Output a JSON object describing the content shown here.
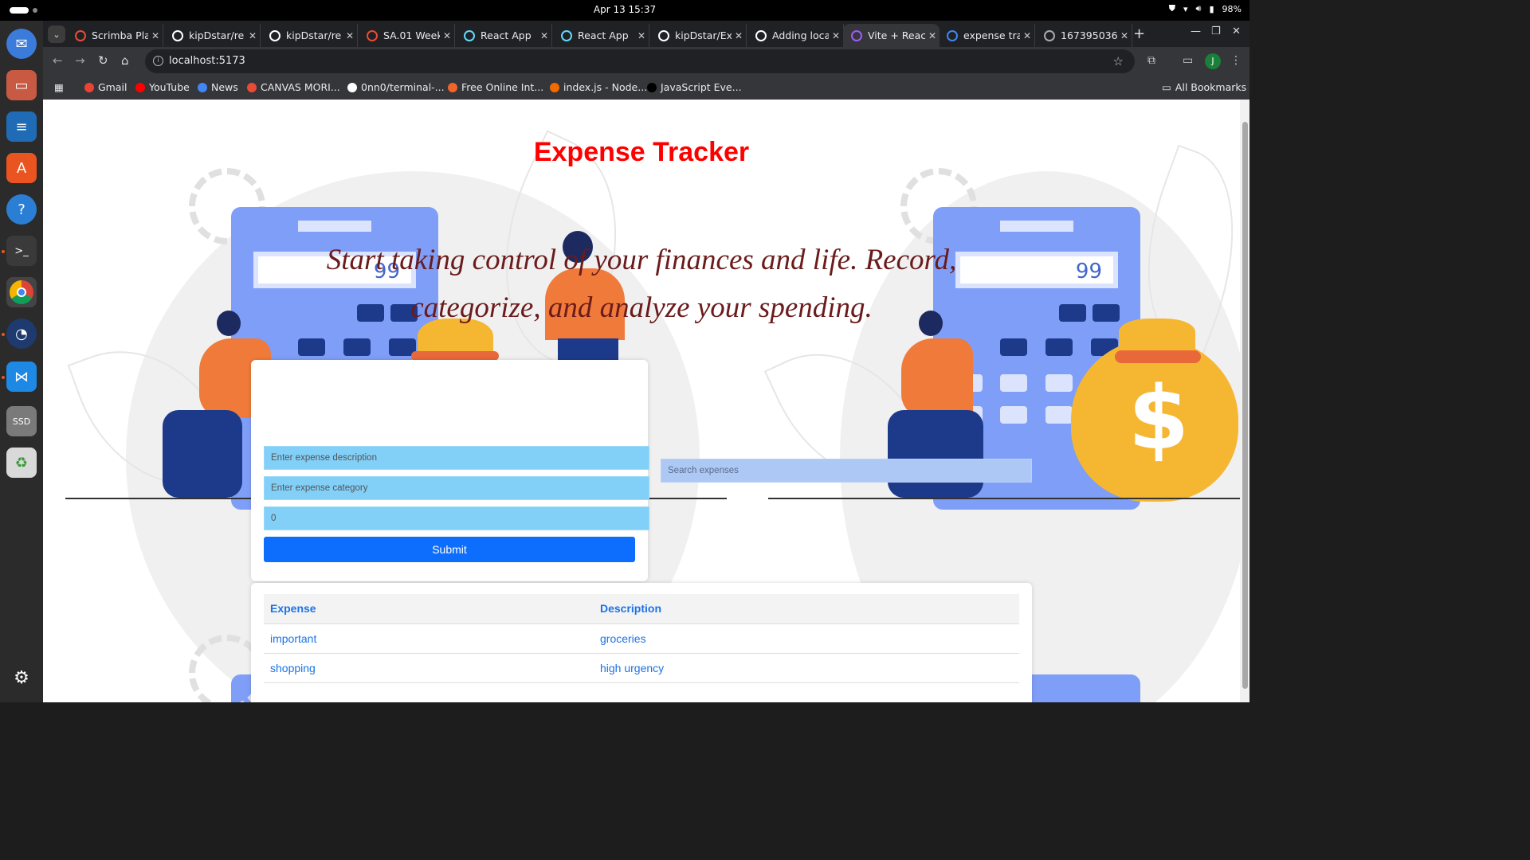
{
  "system_bar": {
    "clock": "Apr 13  15:37",
    "battery": "98%"
  },
  "browser": {
    "tabs": [
      {
        "label": "Scrimba Pla",
        "fav_color": "#e94b35",
        "icon": "scrimba-icon"
      },
      {
        "label": "kipDstar/re",
        "fav_color": "#ffffff",
        "icon": "github-icon"
      },
      {
        "label": "kipDstar/re",
        "fav_color": "#ffffff",
        "icon": "github-icon"
      },
      {
        "label": "SA.01 Week",
        "fav_color": "#e94b35",
        "icon": "scrimba-icon"
      },
      {
        "label": "React App",
        "fav_color": "#61dafb",
        "icon": "react-icon"
      },
      {
        "label": "React App",
        "fav_color": "#61dafb",
        "icon": "react-icon"
      },
      {
        "label": "kipDstar/Ex",
        "fav_color": "#ffffff",
        "icon": "github-icon"
      },
      {
        "label": "Adding loca",
        "fav_color": "#ffffff",
        "icon": "github-icon"
      },
      {
        "label": "Vite + React",
        "fav_color": "#a259ff",
        "icon": "vite-icon"
      },
      {
        "label": "expense tra",
        "fav_color": "#4285f4",
        "icon": "google-icon"
      },
      {
        "label": "167395036",
        "fav_color": "#aaaaaa",
        "icon": "globe-icon"
      }
    ],
    "active_tab_index": 8,
    "url": "localhost:5173",
    "profile_initial": "J",
    "bookmarks": [
      {
        "label": "Gmail",
        "color": "#ea4335"
      },
      {
        "label": "YouTube",
        "color": "#ff0000"
      },
      {
        "label": "News",
        "color": "#4285f4"
      },
      {
        "label": "CANVAS MORI...",
        "color": "#e94b35"
      },
      {
        "label": "0nn0/terminal-...",
        "color": "#ffffff"
      },
      {
        "label": "Free Online Int...",
        "color": "#f06529"
      },
      {
        "label": "index.js - Node...",
        "color": "#f26b00"
      },
      {
        "label": "JavaScript Eve...",
        "color": "#000000"
      }
    ],
    "all_bookmarks": "All Bookmarks"
  },
  "app": {
    "title": "Expense Tracker",
    "tagline": "Start taking control of your finances and life. Record, categorize, and analyze your spending.",
    "form": {
      "description_placeholder": "Enter expense description",
      "category_placeholder": "Enter expense category",
      "amount_value": "0",
      "submit_label": "Submit"
    },
    "search_placeholder": "Search expenses",
    "table": {
      "headers": [
        "Expense",
        "Description"
      ],
      "rows": [
        [
          "important",
          "groceries"
        ],
        [
          "shopping",
          "high urgency"
        ]
      ]
    },
    "calculator_display": "99",
    "colors": {
      "title": "#ff0000",
      "tagline": "#6b1b1b",
      "input_bg": "#82cff7",
      "search_bg": "#adc8f5",
      "submit_bg": "#0d6efd",
      "table_text": "#1a73e8"
    }
  }
}
